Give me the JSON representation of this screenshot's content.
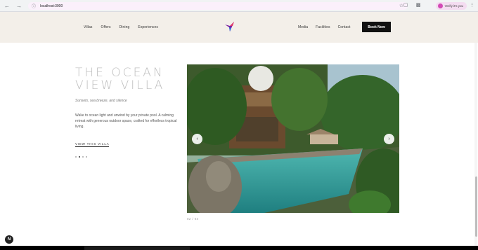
{
  "browser": {
    "url": "localhost:3000",
    "profile_label": "Verify it's you",
    "back_icon": "arrow-left-icon",
    "forward_icon": "arrow-right-icon",
    "reload_icon": "reload-icon"
  },
  "header": {
    "nav_left": [
      "Villas",
      "Offers",
      "Dining",
      "Experiences"
    ],
    "nav_right": [
      "Media",
      "Facilities",
      "Contact"
    ],
    "book_label": "Book Now",
    "colors": {
      "background": "#f3efe9",
      "book_button": "#111111"
    }
  },
  "villa": {
    "title_line1": "THE OCEAN",
    "title_line2": "VIEW VILLA",
    "subtitle": "Sunsets, sea breeze, and silence",
    "description": "Wake to ocean light and unwind by your private pool. A calming retreat with generous outdoor space, crafted for effortless tropical living.",
    "link_label": "VIEW THIS VILLA",
    "slide_dots": 4,
    "active_dot": 1
  },
  "carousel": {
    "counter": "02 / 04",
    "prev_icon": "chevron-left-icon",
    "next_icon": "chevron-right-icon"
  },
  "fab": {
    "label": "N"
  }
}
